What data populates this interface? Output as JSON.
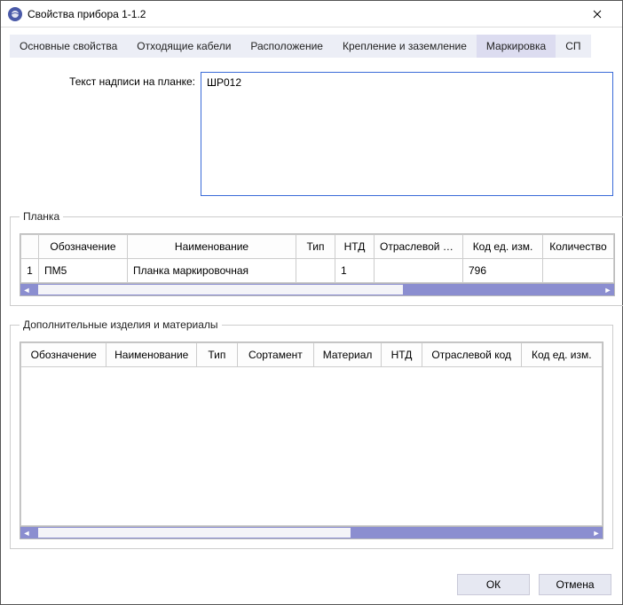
{
  "window": {
    "title": "Свойства прибора 1-1.2"
  },
  "tabs": [
    {
      "label": "Основные свойства",
      "active": false
    },
    {
      "label": "Отходящие кабели",
      "active": false
    },
    {
      "label": "Расположение",
      "active": false
    },
    {
      "label": "Крепление и заземление",
      "active": false
    },
    {
      "label": "Маркировка",
      "active": true
    },
    {
      "label": "СП",
      "active": false
    }
  ],
  "form": {
    "plate_text_label": "Текст надписи на планке:",
    "plate_text_value": "ШР012"
  },
  "group1": {
    "legend": "Планка",
    "columns": [
      "",
      "Обозначение",
      "Наименование",
      "Тип",
      "НТД",
      "Отраслевой код",
      "Код ед. изм.",
      "Количество"
    ],
    "rows": [
      {
        "n": "1",
        "designation": "ПМ5",
        "name": "Планка маркировочная",
        "type": "",
        "ntd": "1",
        "industry_code": "",
        "unit_code": "796",
        "qty": ""
      }
    ],
    "thumb_left_pct": 1,
    "thumb_width_pct": 64
  },
  "group2": {
    "legend": "Дополнительные изделия и материалы",
    "columns": [
      "Обозначение",
      "Наименование",
      "Тип",
      "Сортамент",
      "Материал",
      "НТД",
      "Отраслевой код",
      "Код ед. изм."
    ],
    "thumb_left_pct": 1,
    "thumb_width_pct": 56
  },
  "footer": {
    "ok": "ОК",
    "cancel": "Отмена"
  }
}
